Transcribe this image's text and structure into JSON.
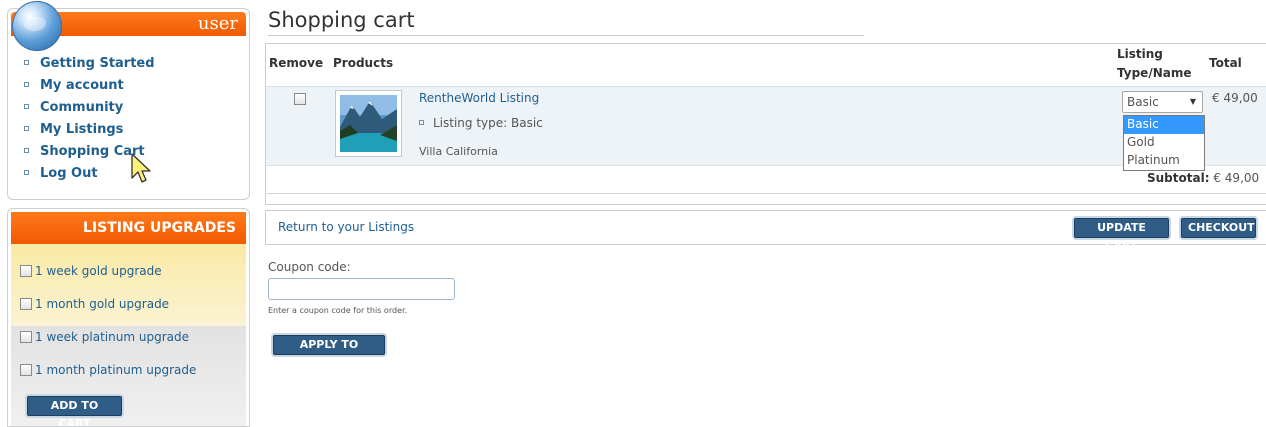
{
  "user_box": {
    "title": "user",
    "menu": [
      {
        "label": "Getting Started"
      },
      {
        "label": "My account"
      },
      {
        "label": "Community"
      },
      {
        "label": "My Listings"
      },
      {
        "label": "Shopping Cart"
      },
      {
        "label": "Log Out"
      }
    ]
  },
  "upgrades": {
    "title": "LISTING UPGRADES",
    "items": [
      {
        "label": "1 week gold upgrade",
        "checked": false
      },
      {
        "label": "1 month gold upgrade",
        "checked": false
      },
      {
        "label": "1 week platinum upgrade",
        "checked": false
      },
      {
        "label": "1 month platinum upgrade",
        "checked": false
      }
    ],
    "button": "ADD TO CART"
  },
  "page": {
    "title": "Shopping cart"
  },
  "cart": {
    "headers": {
      "remove": "Remove",
      "products": "Products",
      "listing_type_line1": "Listing",
      "listing_type_line2": "Type/Name",
      "total": "Total"
    },
    "items": [
      {
        "name": "RentheWorld Listing",
        "type_line": "Listing type: Basic",
        "location": "Villa California",
        "selected_type": "Basic",
        "price": "€ 49,00",
        "remove_checked": false
      }
    ],
    "type_options": [
      "Basic",
      "Gold",
      "Platinum"
    ],
    "subtotal_label": "Subtotal:",
    "subtotal_value": "€ 49,00"
  },
  "actions": {
    "return_link": "Return to your Listings",
    "update": "UPDATE CART",
    "checkout": "CHECKOUT"
  },
  "coupon": {
    "label": "Coupon code:",
    "value": "",
    "placeholder": "",
    "hint": "Enter a coupon code for this order.",
    "apply": "APPLY TO ORDER"
  },
  "colors": {
    "accent_orange": "#f05a00",
    "link_blue": "#1f5f8f",
    "button_blue": "#2f5d86",
    "option_highlight": "#3399ff"
  },
  "icons": [
    "globe-icon",
    "checkbox-icon",
    "mouse-cursor-icon",
    "dropdown-arrow-icon"
  ]
}
